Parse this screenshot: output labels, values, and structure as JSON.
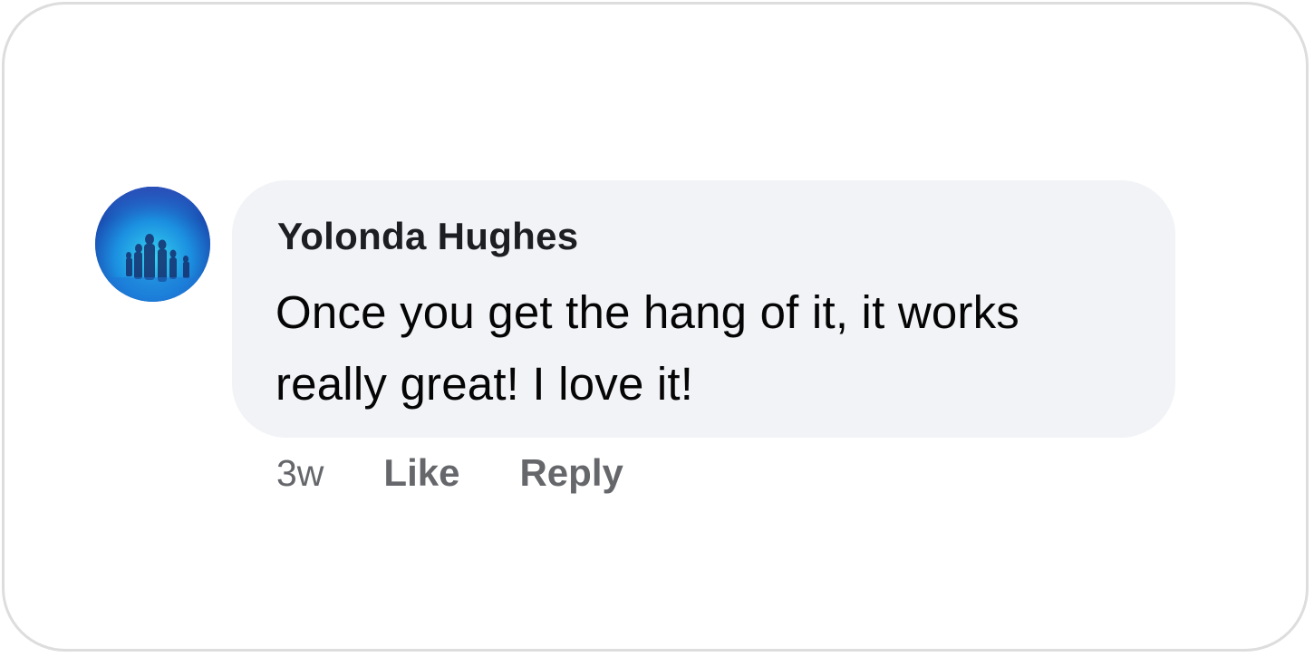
{
  "comment": {
    "author": "Yolonda Hughes",
    "text": "Once you get the hang of it, it works really great! I love it!",
    "avatar_icon": "profile-photo-avatar"
  },
  "actions": {
    "timestamp": "3w",
    "like_label": "Like",
    "reply_label": "Reply"
  },
  "colors": {
    "bubble_bg": "#f2f3f7",
    "author_text": "#1c1e21",
    "meta_text": "#65676b",
    "frame_border": "#dddddd"
  }
}
